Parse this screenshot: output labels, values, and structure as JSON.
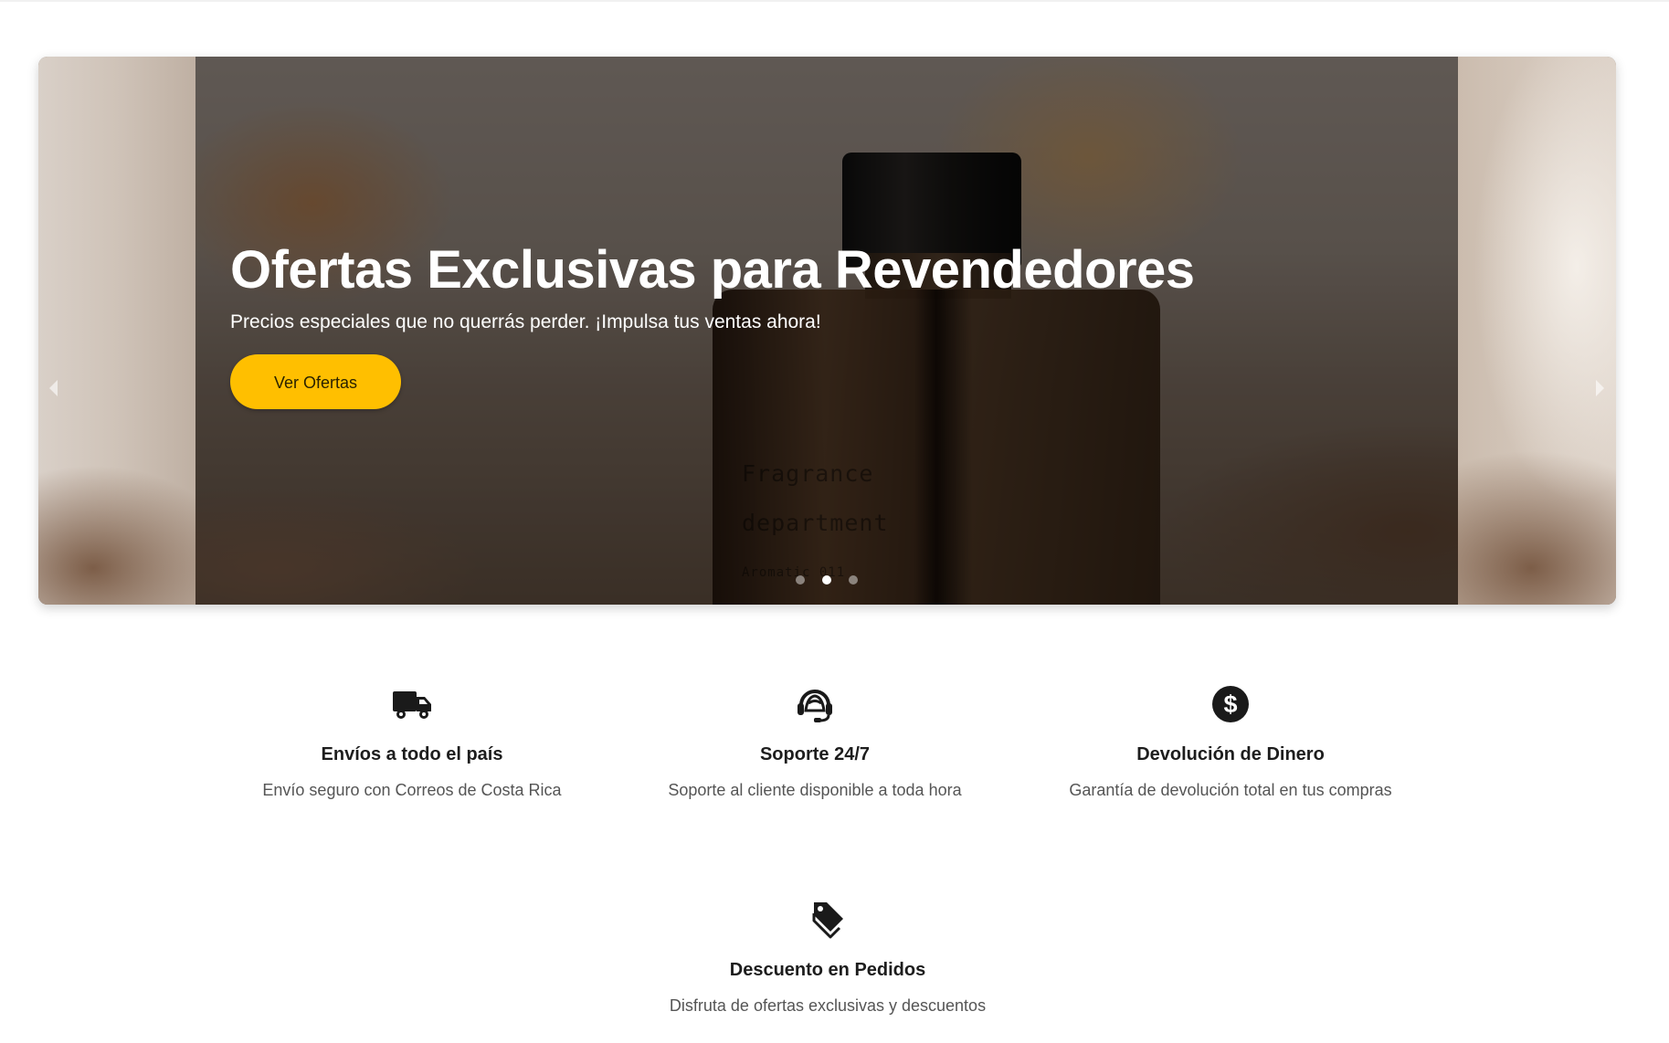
{
  "carousel": {
    "slide_title": "Ofertas Exclusivas para Revendedores",
    "slide_subtitle": "Precios especiales que no querrás perder. ¡Impulsa tus ventas ahora!",
    "cta_label": "Ver Ofertas",
    "active_slide": 2,
    "slide_count": 3,
    "product_text": [
      "Fragrance",
      "department",
      "Aromatic 011"
    ],
    "cta_color": "#ffbf00",
    "prev_icon": "chevron-left-icon",
    "next_icon": "chevron-right-icon"
  },
  "features": [
    {
      "icon": "truck-icon",
      "title": "Envíos a todo el país",
      "description": "Envío seguro con Correos de Costa Rica"
    },
    {
      "icon": "headset-icon",
      "title": "Soporte 24/7",
      "description": "Soporte al cliente disponible a toda hora"
    },
    {
      "icon": "dollar-circle-icon",
      "title": "Devolución de Dinero",
      "description": "Garantía de devolución total en tus compras"
    },
    {
      "icon": "tags-icon",
      "title": "Descuento en Pedidos",
      "description": "Disfruta de ofertas exclusivas y descuentos"
    }
  ]
}
